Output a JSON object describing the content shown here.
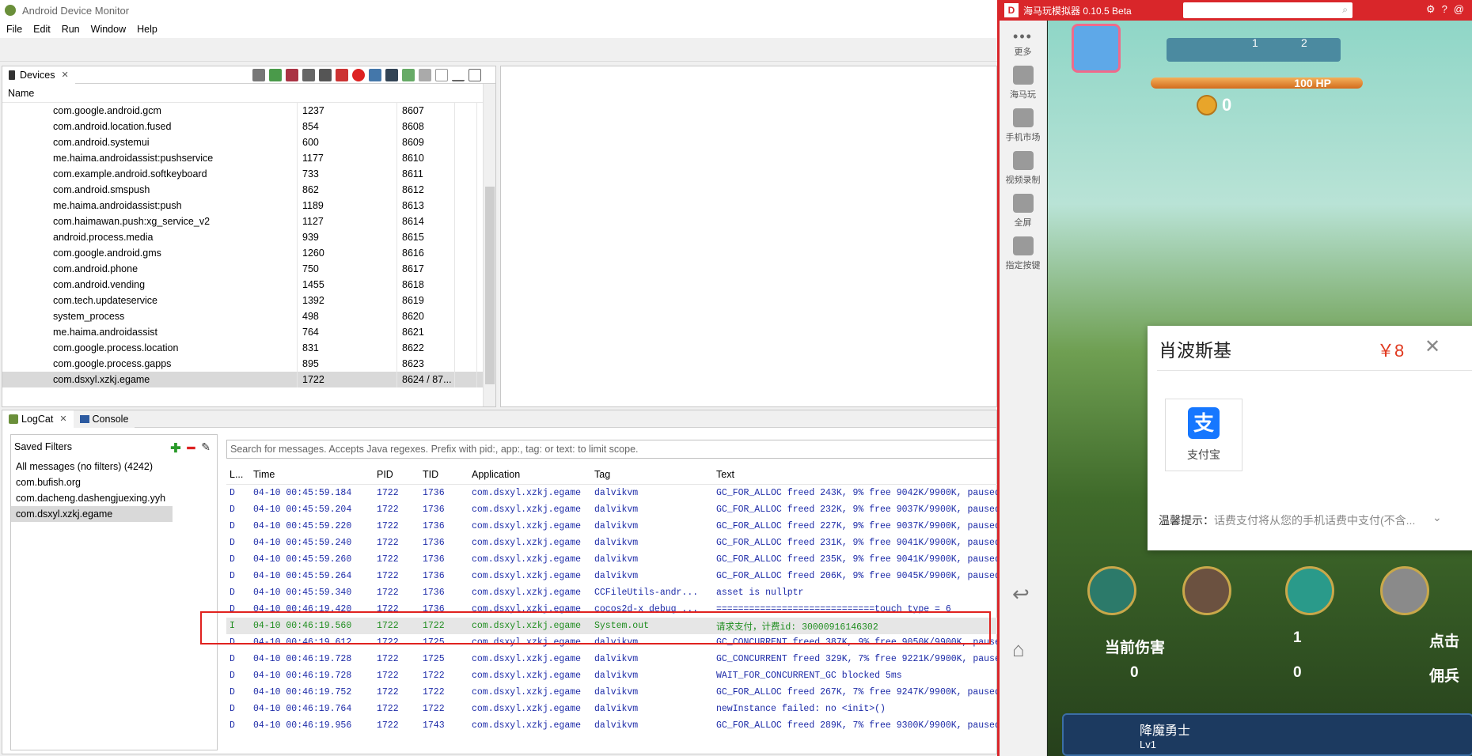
{
  "adm": {
    "title": "Android Device Monitor",
    "menu": [
      "File",
      "Edit",
      "Run",
      "Window",
      "Help"
    ],
    "devices_tab": "Devices",
    "devices_header": "Name",
    "processes": [
      {
        "name": "com.google.android.gcm",
        "pid": "1237",
        "port": "8607"
      },
      {
        "name": "com.android.location.fused",
        "pid": "854",
        "port": "8608"
      },
      {
        "name": "com.android.systemui",
        "pid": "600",
        "port": "8609"
      },
      {
        "name": "me.haima.androidassist:pushservice",
        "pid": "1177",
        "port": "8610"
      },
      {
        "name": "com.example.android.softkeyboard",
        "pid": "733",
        "port": "8611"
      },
      {
        "name": "com.android.smspush",
        "pid": "862",
        "port": "8612"
      },
      {
        "name": "me.haima.androidassist:push",
        "pid": "1189",
        "port": "8613"
      },
      {
        "name": "com.haimawan.push:xg_service_v2",
        "pid": "1127",
        "port": "8614"
      },
      {
        "name": "android.process.media",
        "pid": "939",
        "port": "8615"
      },
      {
        "name": "com.google.android.gms",
        "pid": "1260",
        "port": "8616"
      },
      {
        "name": "com.android.phone",
        "pid": "750",
        "port": "8617"
      },
      {
        "name": "com.android.vending",
        "pid": "1455",
        "port": "8618"
      },
      {
        "name": "com.tech.updateservice",
        "pid": "1392",
        "port": "8619"
      },
      {
        "name": "system_process",
        "pid": "498",
        "port": "8620"
      },
      {
        "name": "me.haima.androidassist",
        "pid": "764",
        "port": "8621"
      },
      {
        "name": "com.google.process.location",
        "pid": "831",
        "port": "8622"
      },
      {
        "name": "com.google.process.gapps",
        "pid": "895",
        "port": "8623"
      },
      {
        "name": "com.dsxyl.xzkj.egame",
        "pid": "1722",
        "port": "8624 / 87..."
      }
    ],
    "logcat_tab": "LogCat",
    "console_tab": "Console",
    "saved_filters_title": "Saved Filters",
    "filters": [
      "All messages (no filters) (4242)",
      "com.bufish.org",
      "com.dacheng.dashengjuexing.yyh",
      "com.dsxyl.xzkj.egame"
    ],
    "search_placeholder": "Search for messages. Accepts Java regexes. Prefix with pid:, app:, tag: or text: to limit scope.",
    "log_headers": [
      "L...",
      "Time",
      "PID",
      "TID",
      "Application",
      "Tag",
      "Text"
    ],
    "logs": [
      {
        "l": "D",
        "time": "04-10 00:45:59.184",
        "pid": "1722",
        "tid": "1736",
        "app": "com.dsxyl.xzkj.egame",
        "tag": "dalvikvm",
        "text": "GC_FOR_ALLOC freed 243K, 9% free 9042K/9900K, paused"
      },
      {
        "l": "D",
        "time": "04-10 00:45:59.204",
        "pid": "1722",
        "tid": "1736",
        "app": "com.dsxyl.xzkj.egame",
        "tag": "dalvikvm",
        "text": "GC_FOR_ALLOC freed 232K, 9% free 9037K/9900K, paused"
      },
      {
        "l": "D",
        "time": "04-10 00:45:59.220",
        "pid": "1722",
        "tid": "1736",
        "app": "com.dsxyl.xzkj.egame",
        "tag": "dalvikvm",
        "text": "GC_FOR_ALLOC freed 227K, 9% free 9037K/9900K, paused"
      },
      {
        "l": "D",
        "time": "04-10 00:45:59.240",
        "pid": "1722",
        "tid": "1736",
        "app": "com.dsxyl.xzkj.egame",
        "tag": "dalvikvm",
        "text": "GC_FOR_ALLOC freed 231K, 9% free 9041K/9900K, paused"
      },
      {
        "l": "D",
        "time": "04-10 00:45:59.260",
        "pid": "1722",
        "tid": "1736",
        "app": "com.dsxyl.xzkj.egame",
        "tag": "dalvikvm",
        "text": "GC_FOR_ALLOC freed 235K, 9% free 9041K/9900K, paused"
      },
      {
        "l": "D",
        "time": "04-10 00:45:59.264",
        "pid": "1722",
        "tid": "1736",
        "app": "com.dsxyl.xzkj.egame",
        "tag": "dalvikvm",
        "text": "GC_FOR_ALLOC freed 206K, 9% free 9045K/9900K, paused"
      },
      {
        "l": "D",
        "time": "04-10 00:45:59.340",
        "pid": "1722",
        "tid": "1736",
        "app": "com.dsxyl.xzkj.egame",
        "tag": "CCFileUtils-andr...",
        "text": "asset is nullptr"
      },
      {
        "l": "D",
        "time": "04-10 00:46:19.420",
        "pid": "1722",
        "tid": "1736",
        "app": "com.dsxyl.xzkj.egame",
        "tag": "cocos2d-x debug ...",
        "text": "=============================touch type = 6"
      },
      {
        "l": "I",
        "time": "04-10 00:46:19.560",
        "pid": "1722",
        "tid": "1722",
        "app": "com.dsxyl.xzkj.egame",
        "tag": "System.out",
        "text": "请求支付，计费id: 30000916146302"
      },
      {
        "l": "D",
        "time": "04-10 00:46:19.612",
        "pid": "1722",
        "tid": "1725",
        "app": "com.dsxyl.xzkj.egame",
        "tag": "dalvikvm",
        "text": "GC_CONCURRENT freed 387K, 9% free 9050K/9900K, paused"
      },
      {
        "l": "D",
        "time": "04-10 00:46:19.728",
        "pid": "1722",
        "tid": "1725",
        "app": "com.dsxyl.xzkj.egame",
        "tag": "dalvikvm",
        "text": "GC_CONCURRENT freed 329K, 7% free 9221K/9900K, paused"
      },
      {
        "l": "D",
        "time": "04-10 00:46:19.728",
        "pid": "1722",
        "tid": "1722",
        "app": "com.dsxyl.xzkj.egame",
        "tag": "dalvikvm",
        "text": "WAIT_FOR_CONCURRENT_GC blocked 5ms"
      },
      {
        "l": "D",
        "time": "04-10 00:46:19.752",
        "pid": "1722",
        "tid": "1722",
        "app": "com.dsxyl.xzkj.egame",
        "tag": "dalvikvm",
        "text": "GC_FOR_ALLOC freed 267K, 7% free 9247K/9900K, paused"
      },
      {
        "l": "D",
        "time": "04-10 00:46:19.764",
        "pid": "1722",
        "tid": "1722",
        "app": "com.dsxyl.xzkj.egame",
        "tag": "dalvikvm",
        "text": "newInstance failed: no <init>()"
      },
      {
        "l": "D",
        "time": "04-10 00:46:19.956",
        "pid": "1722",
        "tid": "1743",
        "app": "com.dsxyl.xzkj.egame",
        "tag": "dalvikvm",
        "text": "GC_FOR_ALLOC freed 289K, 7% free 9300K/9900K, paused"
      }
    ]
  },
  "emu": {
    "title": "海马玩模拟器 0.10.5 Beta",
    "logo": "D",
    "side": [
      "更多",
      "海马玩",
      "手机市场",
      "视频录制",
      "全屏",
      "指定按键"
    ],
    "hp": "100 HP",
    "coins": "0",
    "top_nums": [
      "1",
      "2"
    ],
    "pay": {
      "title": "肖波斯基",
      "price": "￥8",
      "close": "✕",
      "method": "支付宝",
      "method_icon": "支",
      "tip_label": "温馨提示：",
      "tip_text": "话费支付将从您的手机话费中支付(不含..."
    },
    "stats": {
      "dmg_label": "当前伤害",
      "dmg_value": "0",
      "mid_value_top": "1",
      "mid_value": "0",
      "right_label1": "点击",
      "right_label2": "佣兵"
    },
    "hero_name": "降魔勇士",
    "hero_level": "Lv1"
  }
}
